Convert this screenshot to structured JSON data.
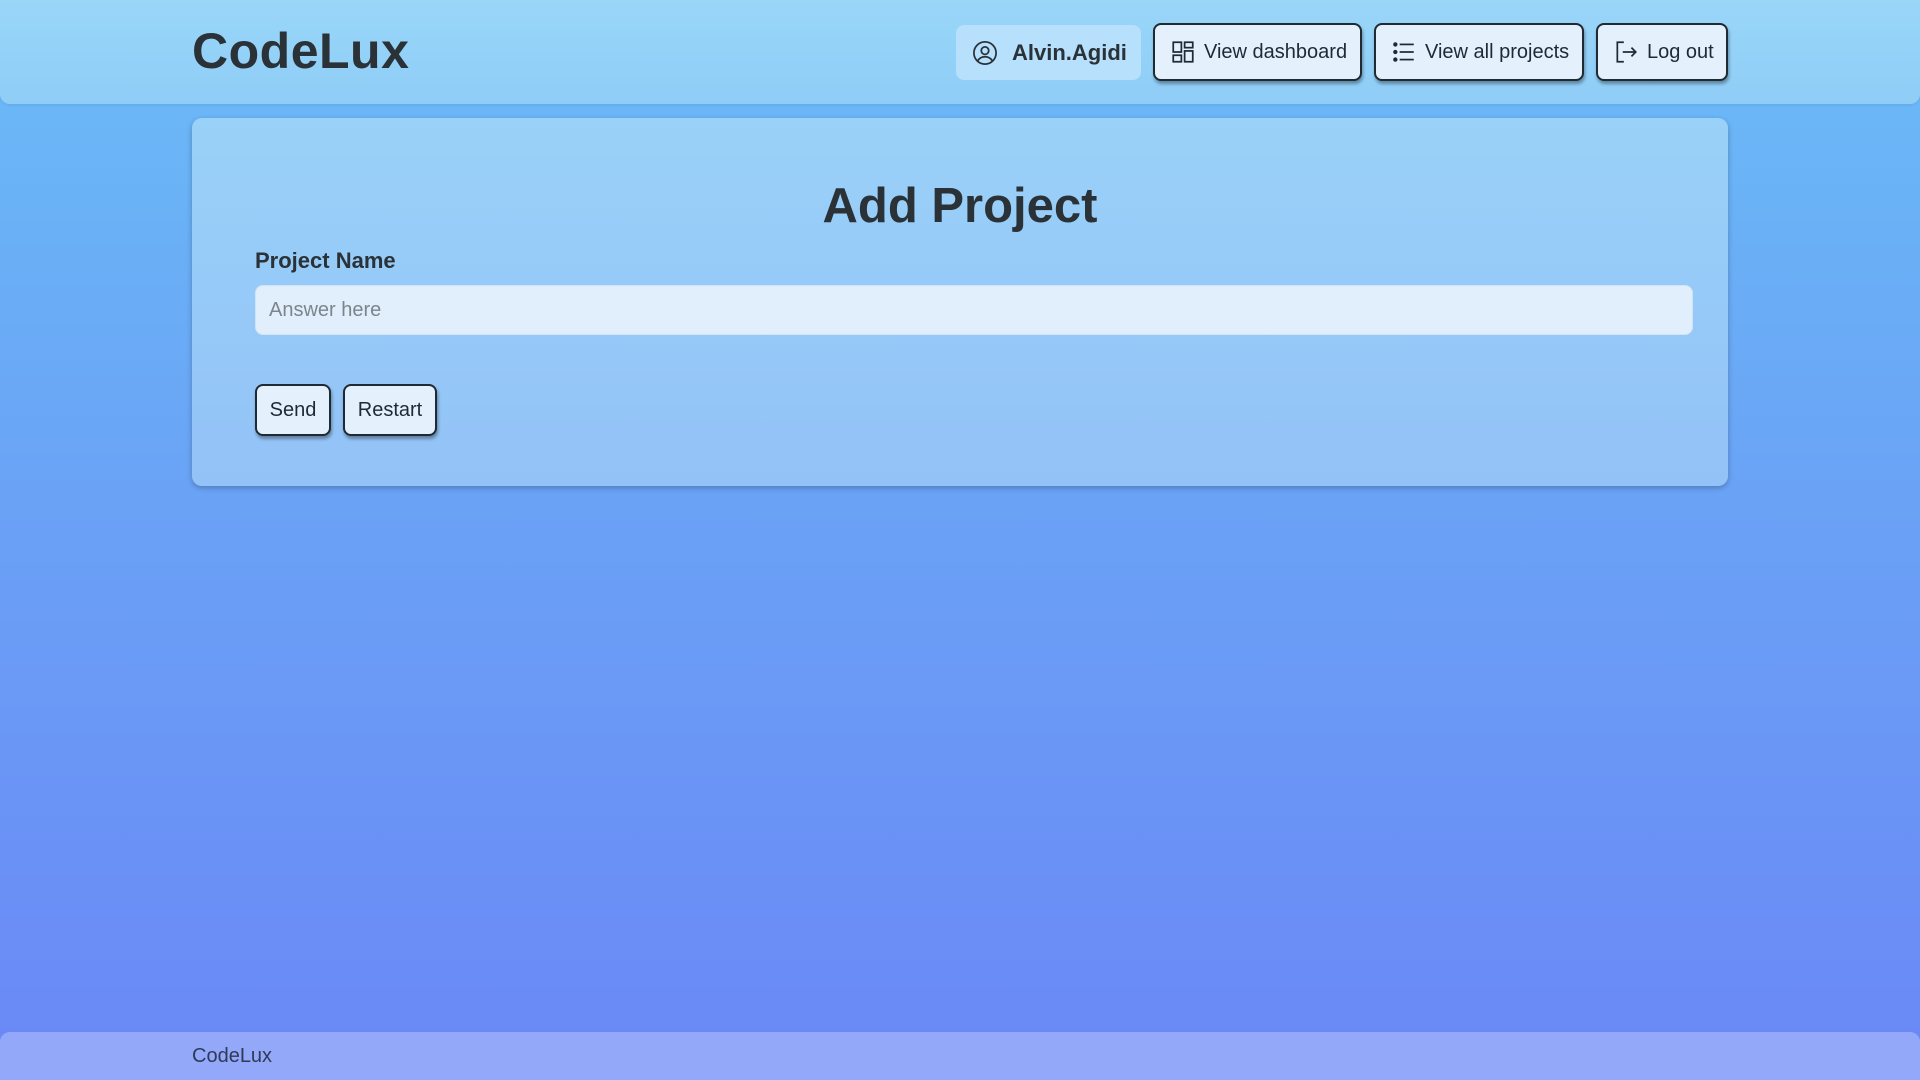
{
  "header": {
    "brand": "CodeLux",
    "user": {
      "name": "Alvin.Agidi",
      "icon": "user-circle-icon"
    },
    "nav": {
      "dashboard": {
        "label": "View dashboard",
        "icon": "grid-icon"
      },
      "projects": {
        "label": "View all projects",
        "icon": "list-icon"
      },
      "logout": {
        "label": "Log out",
        "icon": "logout-icon"
      }
    }
  },
  "form": {
    "title": "Add Project",
    "project_name_label": "Project Name",
    "project_name_value": "",
    "project_name_placeholder": "Answer here",
    "send_label": "Send",
    "restart_label": "Restart"
  },
  "footer": {
    "text": "CodeLux"
  },
  "colors": {
    "header_bg": "#99d6f8",
    "page_gradient_top": "#6bbcf7",
    "page_gradient_bottom": "#6a87f6",
    "button_bg": "#e4f0fb",
    "text_dark": "#2a3238",
    "footer_bg": "#93a8f8"
  }
}
